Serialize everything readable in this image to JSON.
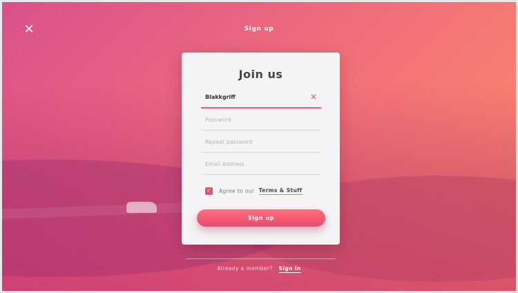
{
  "header": {
    "title": "Sign up",
    "close_icon": "close-icon"
  },
  "form": {
    "title": "Join us",
    "username": {
      "value": "Blakkgriff",
      "clear_icon": "×"
    },
    "password": {
      "placeholder": "Password"
    },
    "repeat_password": {
      "placeholder": "Repeat password"
    },
    "email": {
      "placeholder": "Email Address"
    },
    "agree": {
      "text": "Agree to our",
      "link": "Terms & Stuff",
      "checked": true
    },
    "submit_label": "Sign up"
  },
  "footer": {
    "text": "Already a member?",
    "link": "Sign in"
  },
  "colors": {
    "accent": "#ef4b6e",
    "gradient_start": "#d9508a",
    "gradient_end": "#ff8f63"
  }
}
